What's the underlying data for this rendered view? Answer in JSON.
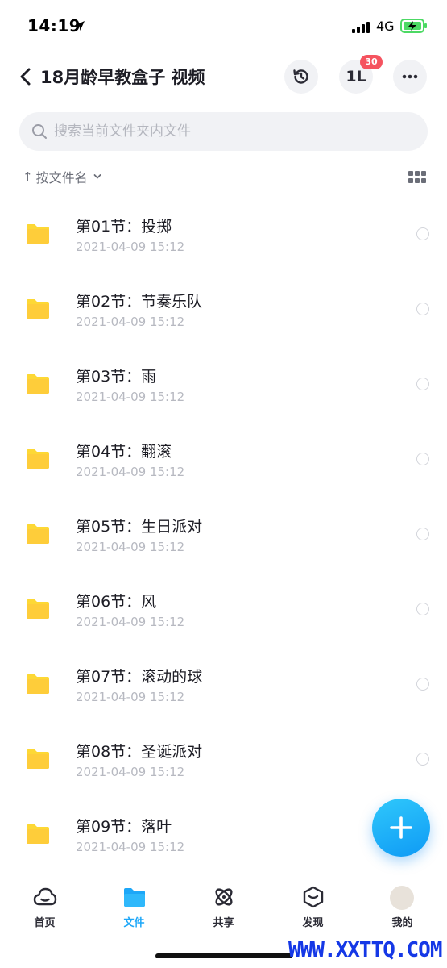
{
  "status_bar": {
    "time": "14:19",
    "network": "4G",
    "icons": [
      "location-arrow-icon",
      "signal-bars-icon",
      "battery-charging-icon"
    ]
  },
  "header": {
    "title": "18月龄早教盒子 视频",
    "transfer_glyph": "1L",
    "transfer_badge": "30",
    "icons": [
      "chevron-left-icon",
      "history-clock-icon",
      "transfer-icon",
      "more-dots-icon"
    ]
  },
  "search": {
    "placeholder": "搜索当前文件夹内文件",
    "value": ""
  },
  "sort": {
    "arrow": "↑",
    "label": "按文件名"
  },
  "files": [
    {
      "name": "第01节：投掷",
      "date": "2021-04-09 15:12"
    },
    {
      "name": "第02节：节奏乐队",
      "date": "2021-04-09 15:12"
    },
    {
      "name": "第03节：雨",
      "date": "2021-04-09 15:12"
    },
    {
      "name": "第04节：翻滚",
      "date": "2021-04-09 15:12"
    },
    {
      "name": "第05节：生日派对",
      "date": "2021-04-09 15:12"
    },
    {
      "name": "第06节：风",
      "date": "2021-04-09 15:12"
    },
    {
      "name": "第07节：滚动的球",
      "date": "2021-04-09 15:12"
    },
    {
      "name": "第08节：圣诞派对",
      "date": "2021-04-09 15:12"
    },
    {
      "name": "第09节：落叶",
      "date": "2021-04-09 15:12"
    }
  ],
  "tabs": [
    {
      "label": "首页",
      "icon": "cloud-home-icon",
      "active": false
    },
    {
      "label": "文件",
      "icon": "folder-icon",
      "active": true
    },
    {
      "label": "共享",
      "icon": "atom-share-icon",
      "active": false
    },
    {
      "label": "发现",
      "icon": "discover-box-icon",
      "active": false
    },
    {
      "label": "我的",
      "icon": "avatar",
      "active": false
    }
  ],
  "watermark": "WWW.XXTTQ.COM",
  "colors": {
    "accent": "#1da7f8",
    "folder": "#fdd835",
    "badge": "#f5535f",
    "watermark": "#1538e6"
  }
}
